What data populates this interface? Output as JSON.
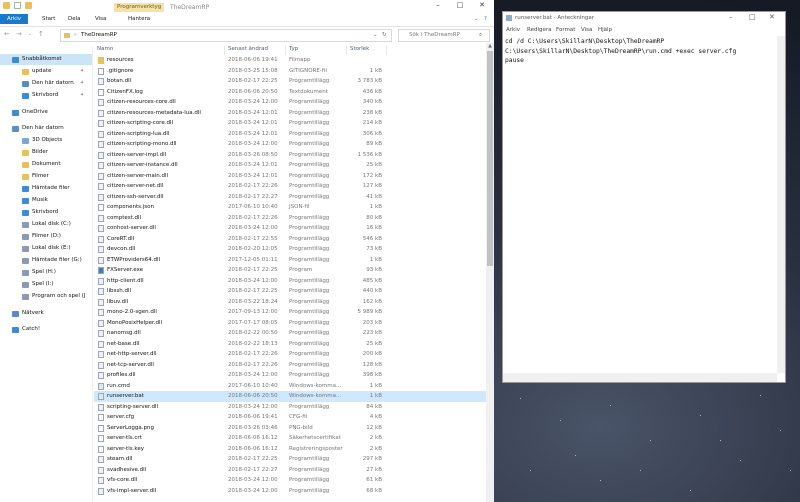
{
  "explorer": {
    "window_title": "TheDreamRP",
    "context_tab": "Programverktyg",
    "ribbon_tabs": {
      "file": "Arkiv",
      "start": "Start",
      "share": "Dela",
      "view": "Visa",
      "manage": "Hantera"
    },
    "address_path": "TheDreamRP",
    "search_placeholder": "Sök i TheDreamRP",
    "columns": {
      "name": "Namn",
      "date": "Senast ändrad",
      "type": "Typ",
      "size": "Storlek"
    },
    "nav_items": [
      {
        "label": "Snabbåtkomst",
        "selected": true
      },
      {
        "label": "update",
        "pinned": true
      },
      {
        "label": "Den här datorn",
        "pinned": true
      },
      {
        "label": "Skrivbord",
        "pinned": true
      },
      {
        "label": "OneDrive"
      },
      {
        "label": "Den här datorn"
      },
      {
        "label": "3D Objects"
      },
      {
        "label": "Bilder"
      },
      {
        "label": "Dokument"
      },
      {
        "label": "Filmer"
      },
      {
        "label": "Hämtade filer"
      },
      {
        "label": "Musik"
      },
      {
        "label": "Skrivbord"
      },
      {
        "label": "Lokal disk (C:)"
      },
      {
        "label": "Filmer (D:)"
      },
      {
        "label": "Lokal disk (E:)"
      },
      {
        "label": "Hämtade filer (G:)"
      },
      {
        "label": "Spel (H:)"
      },
      {
        "label": "Spel (I:)"
      },
      {
        "label": "Program och spel (J"
      },
      {
        "label": "Nätverk"
      },
      {
        "label": "Catch!"
      }
    ],
    "files": [
      {
        "name": "resources",
        "date": "2018-06-06 19:41",
        "type": "Filmapp",
        "size": ""
      },
      {
        "name": ".gitignore",
        "date": "2018-03-25 15:08",
        "type": "GITIGNORE-fil",
        "size": "1 kB"
      },
      {
        "name": "botan.dll",
        "date": "2018-02-17 22:25",
        "type": "Programtillägg",
        "size": "3 783 kB"
      },
      {
        "name": "CitizenFX.log",
        "date": "2018-06-06 20:50",
        "type": "Textdokument",
        "size": "436 kB"
      },
      {
        "name": "citizen-resources-core.dll",
        "date": "2018-03-24 12:00",
        "type": "Programtillägg",
        "size": "340 kB"
      },
      {
        "name": "citizen-resources-metadata-lua.dll",
        "date": "2018-03-24 12:01",
        "type": "Programtillägg",
        "size": "238 kB"
      },
      {
        "name": "citizen-scripting-core.dll",
        "date": "2018-03-24 12:01",
        "type": "Programtillägg",
        "size": "214 kB"
      },
      {
        "name": "citizen-scripting-lua.dll",
        "date": "2018-03-24 12:01",
        "type": "Programtillägg",
        "size": "306 kB"
      },
      {
        "name": "citizen-scripting-mono.dll",
        "date": "2018-03-24 12:00",
        "type": "Programtillägg",
        "size": "89 kB"
      },
      {
        "name": "citizen-server-impl.dll",
        "date": "2018-03-26 08:50",
        "type": "Programtillägg",
        "size": "1 536 kB"
      },
      {
        "name": "citizen-server-instance.dll",
        "date": "2018-03-24 12:01",
        "type": "Programtillägg",
        "size": "25 kB"
      },
      {
        "name": "citizen-server-main.dll",
        "date": "2018-03-24 12:01",
        "type": "Programtillägg",
        "size": "172 kB"
      },
      {
        "name": "citizen-server-net.dll",
        "date": "2018-02-17 22:26",
        "type": "Programtillägg",
        "size": "127 kB"
      },
      {
        "name": "citizen-ssh-server.dll",
        "date": "2018-02-17 22:27",
        "type": "Programtillägg",
        "size": "41 kB"
      },
      {
        "name": "components.json",
        "date": "2017-06-10 10:40",
        "type": "JSON-fil",
        "size": "1 kB"
      },
      {
        "name": "comptest.dll",
        "date": "2018-02-17 22:26",
        "type": "Programtillägg",
        "size": "80 kB"
      },
      {
        "name": "conhost-server.dll",
        "date": "2018-03-24 12:00",
        "type": "Programtillägg",
        "size": "16 kB"
      },
      {
        "name": "CoreRT.dll",
        "date": "2018-02-17 22:55",
        "type": "Programtillägg",
        "size": "546 kB"
      },
      {
        "name": "devcon.dll",
        "date": "2018-02-20 12:05",
        "type": "Programtillägg",
        "size": "73 kB"
      },
      {
        "name": "ETWProviders64.dll",
        "date": "2017-12-05 01:11",
        "type": "Programtillägg",
        "size": "1 kB"
      },
      {
        "name": "FXServer.exe",
        "date": "2018-02-17 22:25",
        "type": "Program",
        "size": "93 kB"
      },
      {
        "name": "http-client.dll",
        "date": "2018-03-24 12:00",
        "type": "Programtillägg",
        "size": "485 kB"
      },
      {
        "name": "libssh.dll",
        "date": "2018-02-17 22:25",
        "type": "Programtillägg",
        "size": "440 kB"
      },
      {
        "name": "libuv.dll",
        "date": "2018-03-22 18:24",
        "type": "Programtillägg",
        "size": "162 kB"
      },
      {
        "name": "mono-2.0-sgen.dll",
        "date": "2017-09-13 12:00",
        "type": "Programtillägg",
        "size": "5 989 kB"
      },
      {
        "name": "MonoPosixHelper.dll",
        "date": "2017-07-17 08:05",
        "type": "Programtillägg",
        "size": "203 kB"
      },
      {
        "name": "nanomsg.dll",
        "date": "2018-02-22 00:50",
        "type": "Programtillägg",
        "size": "223 kB"
      },
      {
        "name": "net-base.dll",
        "date": "2018-02-22 18:13",
        "type": "Programtillägg",
        "size": "25 kB"
      },
      {
        "name": "net-http-server.dll",
        "date": "2018-02-17 22:26",
        "type": "Programtillägg",
        "size": "200 kB"
      },
      {
        "name": "net-tcp-server.dll",
        "date": "2018-02-17 22:26",
        "type": "Programtillägg",
        "size": "128 kB"
      },
      {
        "name": "profiles.dll",
        "date": "2018-03-24 12:00",
        "type": "Programtillägg",
        "size": "398 kB"
      },
      {
        "name": "run.cmd",
        "date": "2017-06-10 10:40",
        "type": "Windows-komma...",
        "size": "1 kB"
      },
      {
        "name": "runserver.bat",
        "date": "2018-06-06 20:50",
        "type": "Windows-komma...",
        "size": "1 kB",
        "selected": true
      },
      {
        "name": "scripting-server.dll",
        "date": "2018-03-24 12:00",
        "type": "Programtillägg",
        "size": "84 kB"
      },
      {
        "name": "server.cfg",
        "date": "2018-06-06 19:41",
        "type": "CFG-fil",
        "size": "4 kB"
      },
      {
        "name": "ServerLogga.png",
        "date": "2018-03-26 03:46",
        "type": "PNG-bild",
        "size": "12 kB"
      },
      {
        "name": "server-tls.crt",
        "date": "2018-06-06 16:12",
        "type": "Säkerhetscertifikat",
        "size": "2 kB"
      },
      {
        "name": "server-tls.key",
        "date": "2018-06-06 16:12",
        "type": "Registreringsposter",
        "size": "2 kB"
      },
      {
        "name": "steam.dll",
        "date": "2018-02-17 22:25",
        "type": "Programtillägg",
        "size": "297 kB"
      },
      {
        "name": "svadhesive.dll",
        "date": "2018-02-17 22:27",
        "type": "Programtillägg",
        "size": "27 kB"
      },
      {
        "name": "vfs-core.dll",
        "date": "2018-03-24 12:00",
        "type": "Programtillägg",
        "size": "61 kB"
      },
      {
        "name": "vfs-impl-server.dll",
        "date": "2018-03-24 12:00",
        "type": "Programtillägg",
        "size": "68 kB"
      }
    ]
  },
  "notepad": {
    "title": "runserver.bat - Anteckningar",
    "menu": [
      "Arkiv",
      "Redigera",
      "Format",
      "Visa",
      "Hjälp"
    ],
    "lines": [
      "cd /d C:\\Users\\SkillarN\\Desktop\\TheDreamRP",
      "C:\\Users\\SkillarN\\Desktop\\TheDreamRP\\run.cmd +exec server.cfg",
      "pause"
    ]
  },
  "colors": {
    "accent": "#1979ca",
    "selection": "#cde8ff",
    "context_tab": "#f6e3a3",
    "folder": "#e8c15c"
  }
}
